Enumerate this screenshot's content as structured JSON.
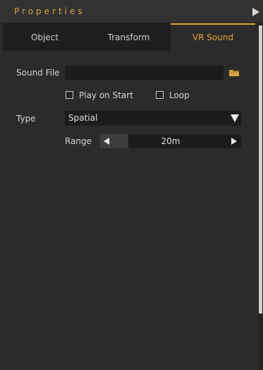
{
  "panel": {
    "title": "Properties"
  },
  "tabs": [
    {
      "label": "Object",
      "active": false
    },
    {
      "label": "Transform",
      "active": false
    },
    {
      "label": "VR Sound",
      "active": true
    }
  ],
  "sound_file": {
    "label": "Sound File",
    "value": "",
    "placeholder": ""
  },
  "options": {
    "play_on_start_label": "Play on Start",
    "play_on_start_checked": false,
    "loop_label": "Loop",
    "loop_checked": false
  },
  "type": {
    "label": "Type",
    "selected": "Spatial"
  },
  "range": {
    "label": "Range",
    "value_text": "20m",
    "fill_fraction": 0.2
  },
  "colors": {
    "accent": "#e0a533",
    "background": "#2b2b2b",
    "field": "#1c1c1c"
  },
  "icons": {
    "collapse": "triangle-right-icon",
    "folder": "folder-icon",
    "dropdown": "triangle-down-icon",
    "range_left": "triangle-left-icon",
    "range_right": "triangle-right-icon"
  }
}
